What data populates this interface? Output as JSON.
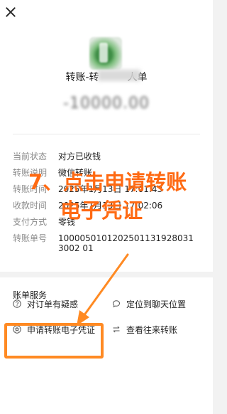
{
  "header": {
    "title_prefix": "转账-转",
    "title_suffix": "人单"
  },
  "amount": "-10000.00",
  "details": [
    {
      "label": "当前状态",
      "value": "对方已收钱"
    },
    {
      "label": "转账说明",
      "value": "微信转账"
    },
    {
      "label": "转账时间",
      "value": "2025年1月13日 17:01:43"
    },
    {
      "label": "收款时间",
      "value": "2025年1月13日 17:02:06"
    },
    {
      "label": "支付方式",
      "value": "零钱"
    },
    {
      "label": "转账单号",
      "value": "10000501012025011319280313002 01"
    }
  ],
  "annotation": {
    "line1": "7、点击申请转账",
    "line2": "电子凭证",
    "color": "#ff6a13"
  },
  "services": {
    "title": "账单服务",
    "items": [
      {
        "label": "对订单有疑惑",
        "icon": "question-icon"
      },
      {
        "label": "定位到聊天位置",
        "icon": "chat-bubble-icon"
      },
      {
        "label": "申请转账电子凭证",
        "icon": "badge-icon"
      },
      {
        "label": "查看往来转账",
        "icon": "swap-arrows-icon"
      }
    ]
  },
  "colors": {
    "highlight": "#ff8a23"
  }
}
